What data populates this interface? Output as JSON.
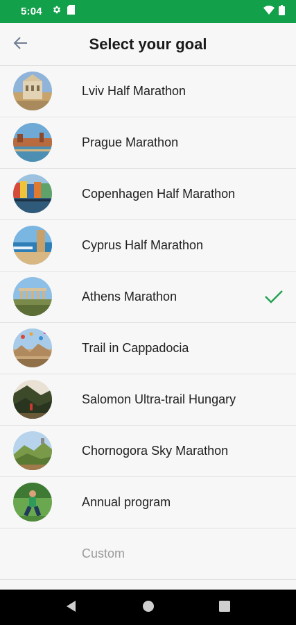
{
  "status_bar": {
    "time": "5:04",
    "icons": [
      "settings-icon",
      "sd-card-icon",
      "wifi-icon",
      "battery-icon"
    ],
    "color": "#12a04a"
  },
  "app_bar": {
    "title": "Select your goal",
    "back_icon": "arrow-left-icon"
  },
  "goals": [
    {
      "label": "Lviv Half Marathon",
      "selected": false
    },
    {
      "label": "Prague Marathon",
      "selected": false
    },
    {
      "label": "Copenhagen Half Marathon",
      "selected": false
    },
    {
      "label": "Cyprus Half Marathon",
      "selected": false
    },
    {
      "label": "Athens Marathon",
      "selected": true
    },
    {
      "label": "Trail in Cappadocia",
      "selected": false
    },
    {
      "label": "Salomon Ultra-trail Hungary",
      "selected": false
    },
    {
      "label": "Chornogora Sky Marathon",
      "selected": false
    },
    {
      "label": "Annual program",
      "selected": false
    }
  ],
  "custom": {
    "label": "Custom"
  },
  "check_color": "#21a04f",
  "nav_bar": {
    "icons": [
      "back-triangle-icon",
      "home-circle-icon",
      "recents-square-icon"
    ]
  }
}
